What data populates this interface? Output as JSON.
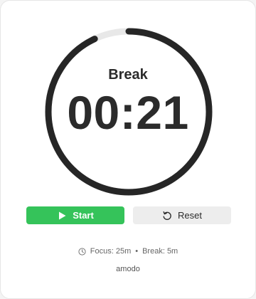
{
  "timer": {
    "mode": "Break",
    "remaining": "00:21",
    "elapsed_fraction": 0.07
  },
  "controls": {
    "start_label": "Start",
    "reset_label": "Reset"
  },
  "settings": {
    "focus": "Focus: 25m",
    "separator": "•",
    "break": "Break: 5m"
  },
  "brand": "amodo",
  "colors": {
    "ring": "#262626",
    "ring_track": "#e8e8e8",
    "start": "#35c35a",
    "reset": "#ededed"
  },
  "icons": {
    "start": "play-icon",
    "reset": "reset-icon",
    "settings": "clock-icon"
  }
}
